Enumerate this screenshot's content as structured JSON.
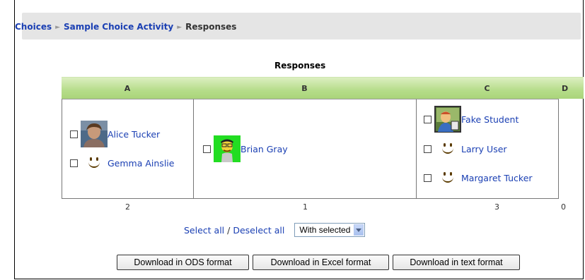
{
  "breadcrumb": {
    "cut_item": "/",
    "items": [
      "Choices",
      "Sample Choice Activity",
      "Responses"
    ]
  },
  "responses_title": "Responses",
  "columns": [
    {
      "header": "A",
      "count": "2",
      "people": [
        {
          "name": "Alice Tucker",
          "avatar": "photo"
        },
        {
          "name": "Gemma Ainslie",
          "avatar": "smiley"
        }
      ]
    },
    {
      "header": "B",
      "count": "1",
      "people": [
        {
          "name": "Brian Gray",
          "avatar": "cartoon-man"
        }
      ]
    },
    {
      "header": "C",
      "count": "3",
      "people": [
        {
          "name": "Fake Student",
          "avatar": "cartoon-student"
        },
        {
          "name": "Larry User",
          "avatar": "smiley"
        },
        {
          "name": "Margaret Tucker",
          "avatar": "smiley"
        }
      ]
    },
    {
      "header": "D",
      "count": "0",
      "people": []
    }
  ],
  "selection": {
    "select_all": "Select all",
    "separator": " / ",
    "deselect_all": "Deselect all",
    "with_selected": "With selected"
  },
  "buttons": {
    "ods": "Download in ODS format",
    "excel": "Download in Excel format",
    "text": "Download in text format"
  },
  "colors": {
    "link": "#1a3fb3",
    "header_green": "#b6dd8a",
    "crumb_bg": "#e5e5e5"
  }
}
